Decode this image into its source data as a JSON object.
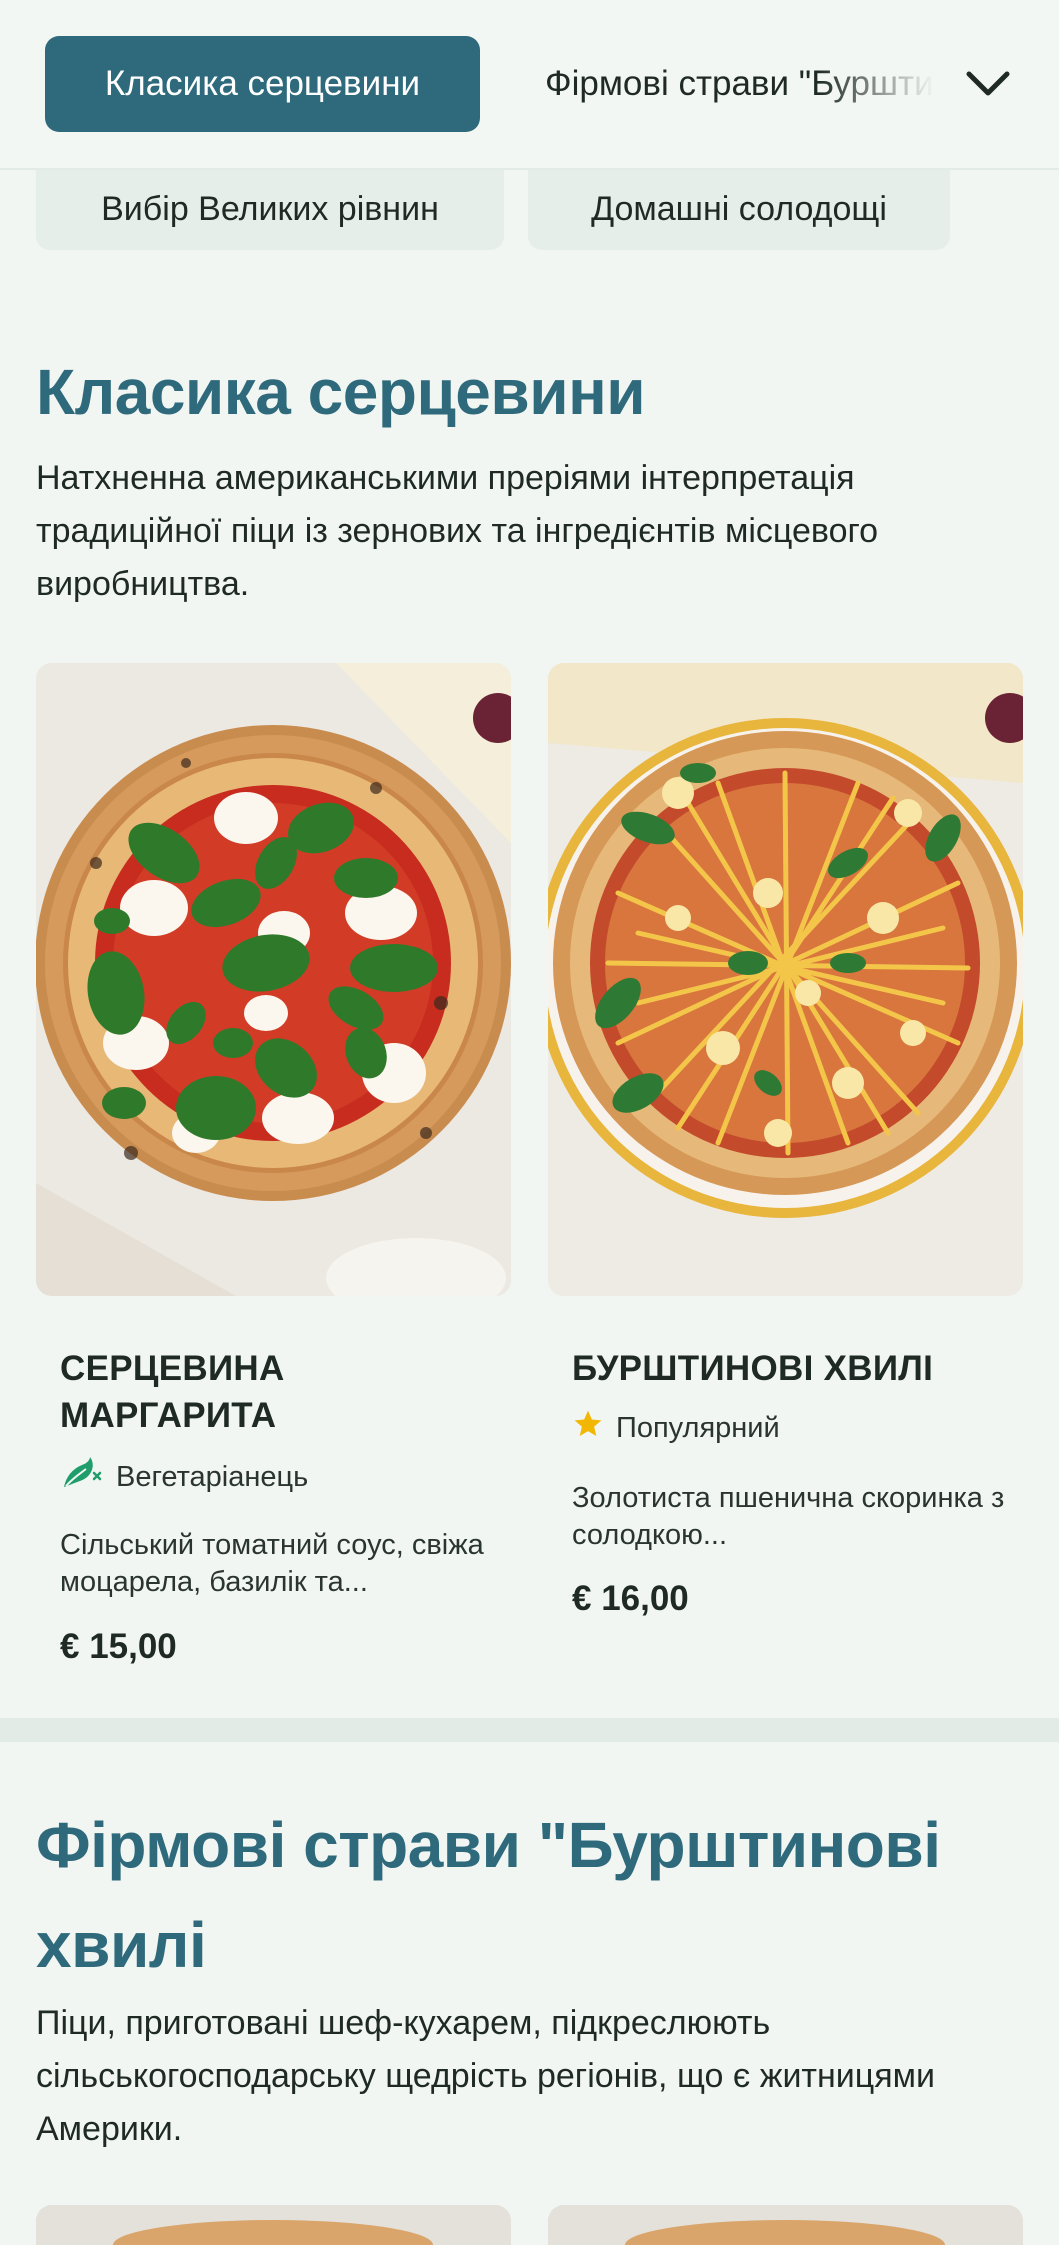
{
  "tabs": {
    "active_label": "Класика серцевини",
    "next_label": "Фірмові страви \"Бурштинові хвилі"
  },
  "chips": [
    "Вибір Великих рівнин",
    "Домашні солодощі"
  ],
  "sections": [
    {
      "title": "Класика серцевини",
      "description": "Натхненна американськими преріями інтерпретація традиційної піци із зернових та інгредієнтів місцевого виробництва.",
      "items": [
        {
          "name": "СЕРЦЕВИНА МАРГАРИТА",
          "tag": "Вегетаріанець",
          "tag_icon": "vegetarian-leaf-icon",
          "description": "Сільський томатний соус, свіжа моцарела, базилік та...",
          "price": "€ 15,00"
        },
        {
          "name": "БУРШТИНОВІ ХВИЛІ",
          "tag": "Популярний",
          "tag_icon": "star-icon",
          "description": "Золотиста пшенична скоринка з солодкою...",
          "price": "€ 16,00"
        }
      ]
    },
    {
      "title": "Фірмові страви \"Бурштинові хвилі",
      "description": "Піци, приготовані шеф-кухарем, підкреслюють сільськогосподарську щедрість регіонів, що є житницями Америки."
    }
  ],
  "colors": {
    "accent": "#2f6a7c",
    "background": "#f1f6f2",
    "star": "#f2b705",
    "veg": "#1f9d6b"
  }
}
